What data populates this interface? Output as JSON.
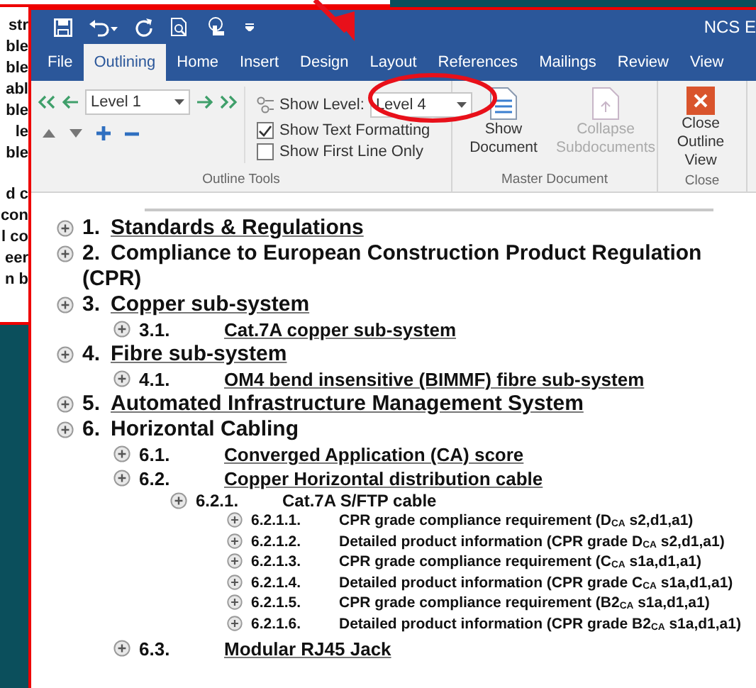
{
  "background_document": {
    "fragments": [
      "str",
      "ble",
      "ble",
      "abl",
      "ble",
      "le",
      "ble",
      "d c",
      "con",
      "l co",
      "eer",
      "n b"
    ]
  },
  "title_bar": {
    "title": "NCS E"
  },
  "tabs": [
    {
      "label": "File",
      "selected": false
    },
    {
      "label": "Outlining",
      "selected": true
    },
    {
      "label": "Home",
      "selected": false
    },
    {
      "label": "Insert",
      "selected": false
    },
    {
      "label": "Design",
      "selected": false
    },
    {
      "label": "Layout",
      "selected": false
    },
    {
      "label": "References",
      "selected": false
    },
    {
      "label": "Mailings",
      "selected": false
    },
    {
      "label": "Review",
      "selected": false
    },
    {
      "label": "View",
      "selected": false
    }
  ],
  "outline_tools": {
    "level_field": {
      "value": "Level 1"
    },
    "show_level": {
      "label": "Show Level:",
      "value": "Level 4"
    },
    "options": [
      {
        "label": "Show Text Formatting",
        "checked": true
      },
      {
        "label": "Show First Line Only",
        "checked": false
      }
    ],
    "group_label": "Outline Tools"
  },
  "master_document": {
    "buttons": [
      {
        "label": "Show Document",
        "disabled": false
      },
      {
        "label": "Collapse Subdocuments",
        "disabled": true
      }
    ],
    "group_label": "Master Document"
  },
  "close_group": {
    "button": "Close Outline View",
    "group_label": "Close"
  },
  "outline": [
    {
      "number": "1.",
      "text": "Standards & Regulations",
      "underlined": true
    },
    {
      "number": "2.",
      "text": "Compliance to European Construction Product Regulation (CPR)",
      "underlined": false
    },
    {
      "number": "3.",
      "text": "Copper sub-system",
      "underlined": true,
      "children": [
        {
          "number": "3.1.",
          "text": "Cat.7A copper sub-system",
          "underlined": true
        }
      ]
    },
    {
      "number": "4.",
      "text": "Fibre sub-system",
      "underlined": true,
      "children": [
        {
          "number": "4.1.",
          "text": "OM4 bend insensitive (BIMMF) fibre sub-system",
          "underlined": true
        }
      ]
    },
    {
      "number": "5.",
      "text": "Automated Infrastructure Management System",
      "underlined": true
    },
    {
      "number": "6.",
      "text": "Horizontal Cabling",
      "underlined": false,
      "children": [
        {
          "number": "6.1.",
          "text": "Converged Application (CA) score",
          "underlined": true
        },
        {
          "number": "6.2.",
          "text": "Copper Horizontal distribution cable",
          "underlined": true,
          "children": [
            {
              "number": "6.2.1.",
              "text": "Cat.7A S/FTP cable",
              "underlined": false,
              "children": [
                {
                  "number": "6.2.1.1.",
                  "text": "CPR grade compliance requirement (D$_{CA}$ s2,d1,a1)",
                  "underlined": false
                },
                {
                  "number": "6.2.1.2.",
                  "text": "Detailed product information (CPR grade D$_{CA}$ s2,d1,a1)",
                  "underlined": false
                },
                {
                  "number": "6.2.1.3.",
                  "text": "CPR grade compliance requirement (C$_{CA}$ s1a,d1,a1)",
                  "underlined": false
                },
                {
                  "number": "6.2.1.4.",
                  "text": "Detailed product information (CPR grade C$_{CA}$ s1a,d1,a1)",
                  "underlined": false
                },
                {
                  "number": "6.2.1.5.",
                  "text": "CPR grade compliance requirement (B2$_{CA}$ s1a,d1,a1)",
                  "underlined": false
                },
                {
                  "number": "6.2.1.6.",
                  "text": "Detailed product information (CPR grade B2$_{CA}$ s1a,d1,a1)",
                  "underlined": false
                }
              ]
            }
          ]
        },
        {
          "number": "6.3.",
          "text": "Modular RJ45 Jack",
          "underlined": true
        }
      ]
    }
  ]
}
